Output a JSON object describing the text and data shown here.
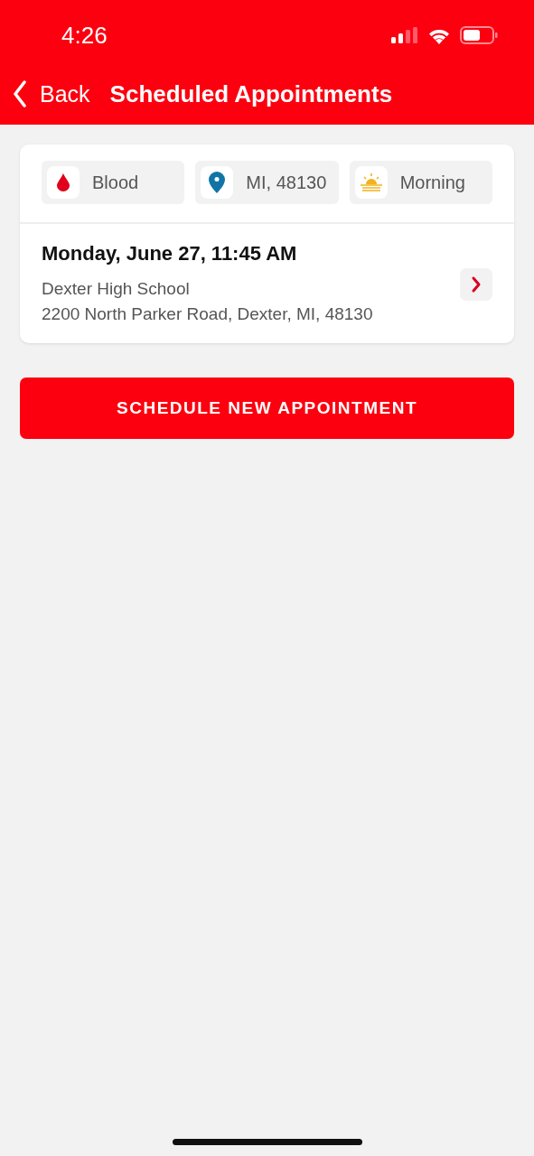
{
  "status_bar": {
    "time": "4:26"
  },
  "nav": {
    "back": "Back",
    "title": "Scheduled Appointments"
  },
  "appointments": [
    {
      "tags": [
        {
          "kind": "blood",
          "label": "Blood"
        },
        {
          "kind": "location",
          "label": "MI, 48130"
        },
        {
          "kind": "time",
          "label": "Morning"
        }
      ],
      "datetime": "Monday, June 27, 11:45 AM",
      "place": "Dexter High School",
      "address": "2200 North Parker Road, Dexter, MI, 48130"
    }
  ],
  "action": "SCHEDULE NEW APPOINTMENT"
}
